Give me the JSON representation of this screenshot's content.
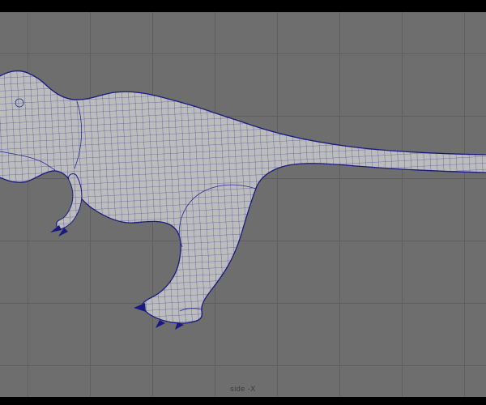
{
  "window": {
    "type": "3d-viewport",
    "camera_label": "side -X"
  },
  "model": {
    "name": "tyrannosaurus-rex",
    "description": "wireframe-on-shaded T-Rex model in side view, facing left, tail exiting right edge"
  },
  "colors": {
    "letterbox": "#000000",
    "viewport_background": "#6e6e6e",
    "grid_line": "#5f5f5f",
    "model_fill": "#bcbcbc",
    "wireframe": "#2a2a96",
    "outline": "#191980",
    "label_text": "#3a3a3a"
  }
}
